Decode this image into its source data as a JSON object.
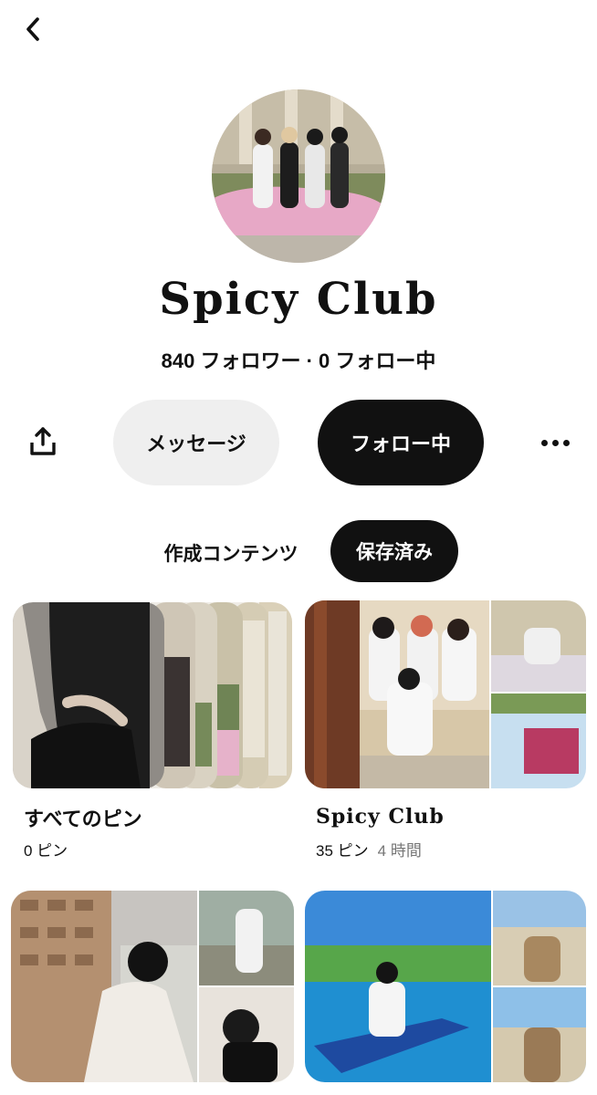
{
  "nav": {
    "back_icon": "chevron-left-icon"
  },
  "profile": {
    "name": "Spicy Club",
    "followers_text": "840 フォロワー · 0  フォロー中"
  },
  "actions": {
    "share_icon": "share-icon",
    "message_label": "メッセージ",
    "follow_label": "フォロー中",
    "more_icon": "more-horizontal-icon"
  },
  "tabs": [
    {
      "label": "作成コンテンツ",
      "selected": false
    },
    {
      "label": "保存済み",
      "selected": true
    }
  ],
  "boards": [
    {
      "title": "すべてのピン",
      "pins": "0 ピン",
      "time": ""
    },
    {
      "title": "Spicy Club",
      "pins": "35 ピン",
      "time": "4 時間"
    },
    {
      "title": "",
      "pins": "",
      "time": ""
    },
    {
      "title": "",
      "pins": "",
      "time": ""
    }
  ],
  "colors": {
    "accent": "#111111",
    "muted_button": "#efefef",
    "meta_gray": "#767676"
  }
}
